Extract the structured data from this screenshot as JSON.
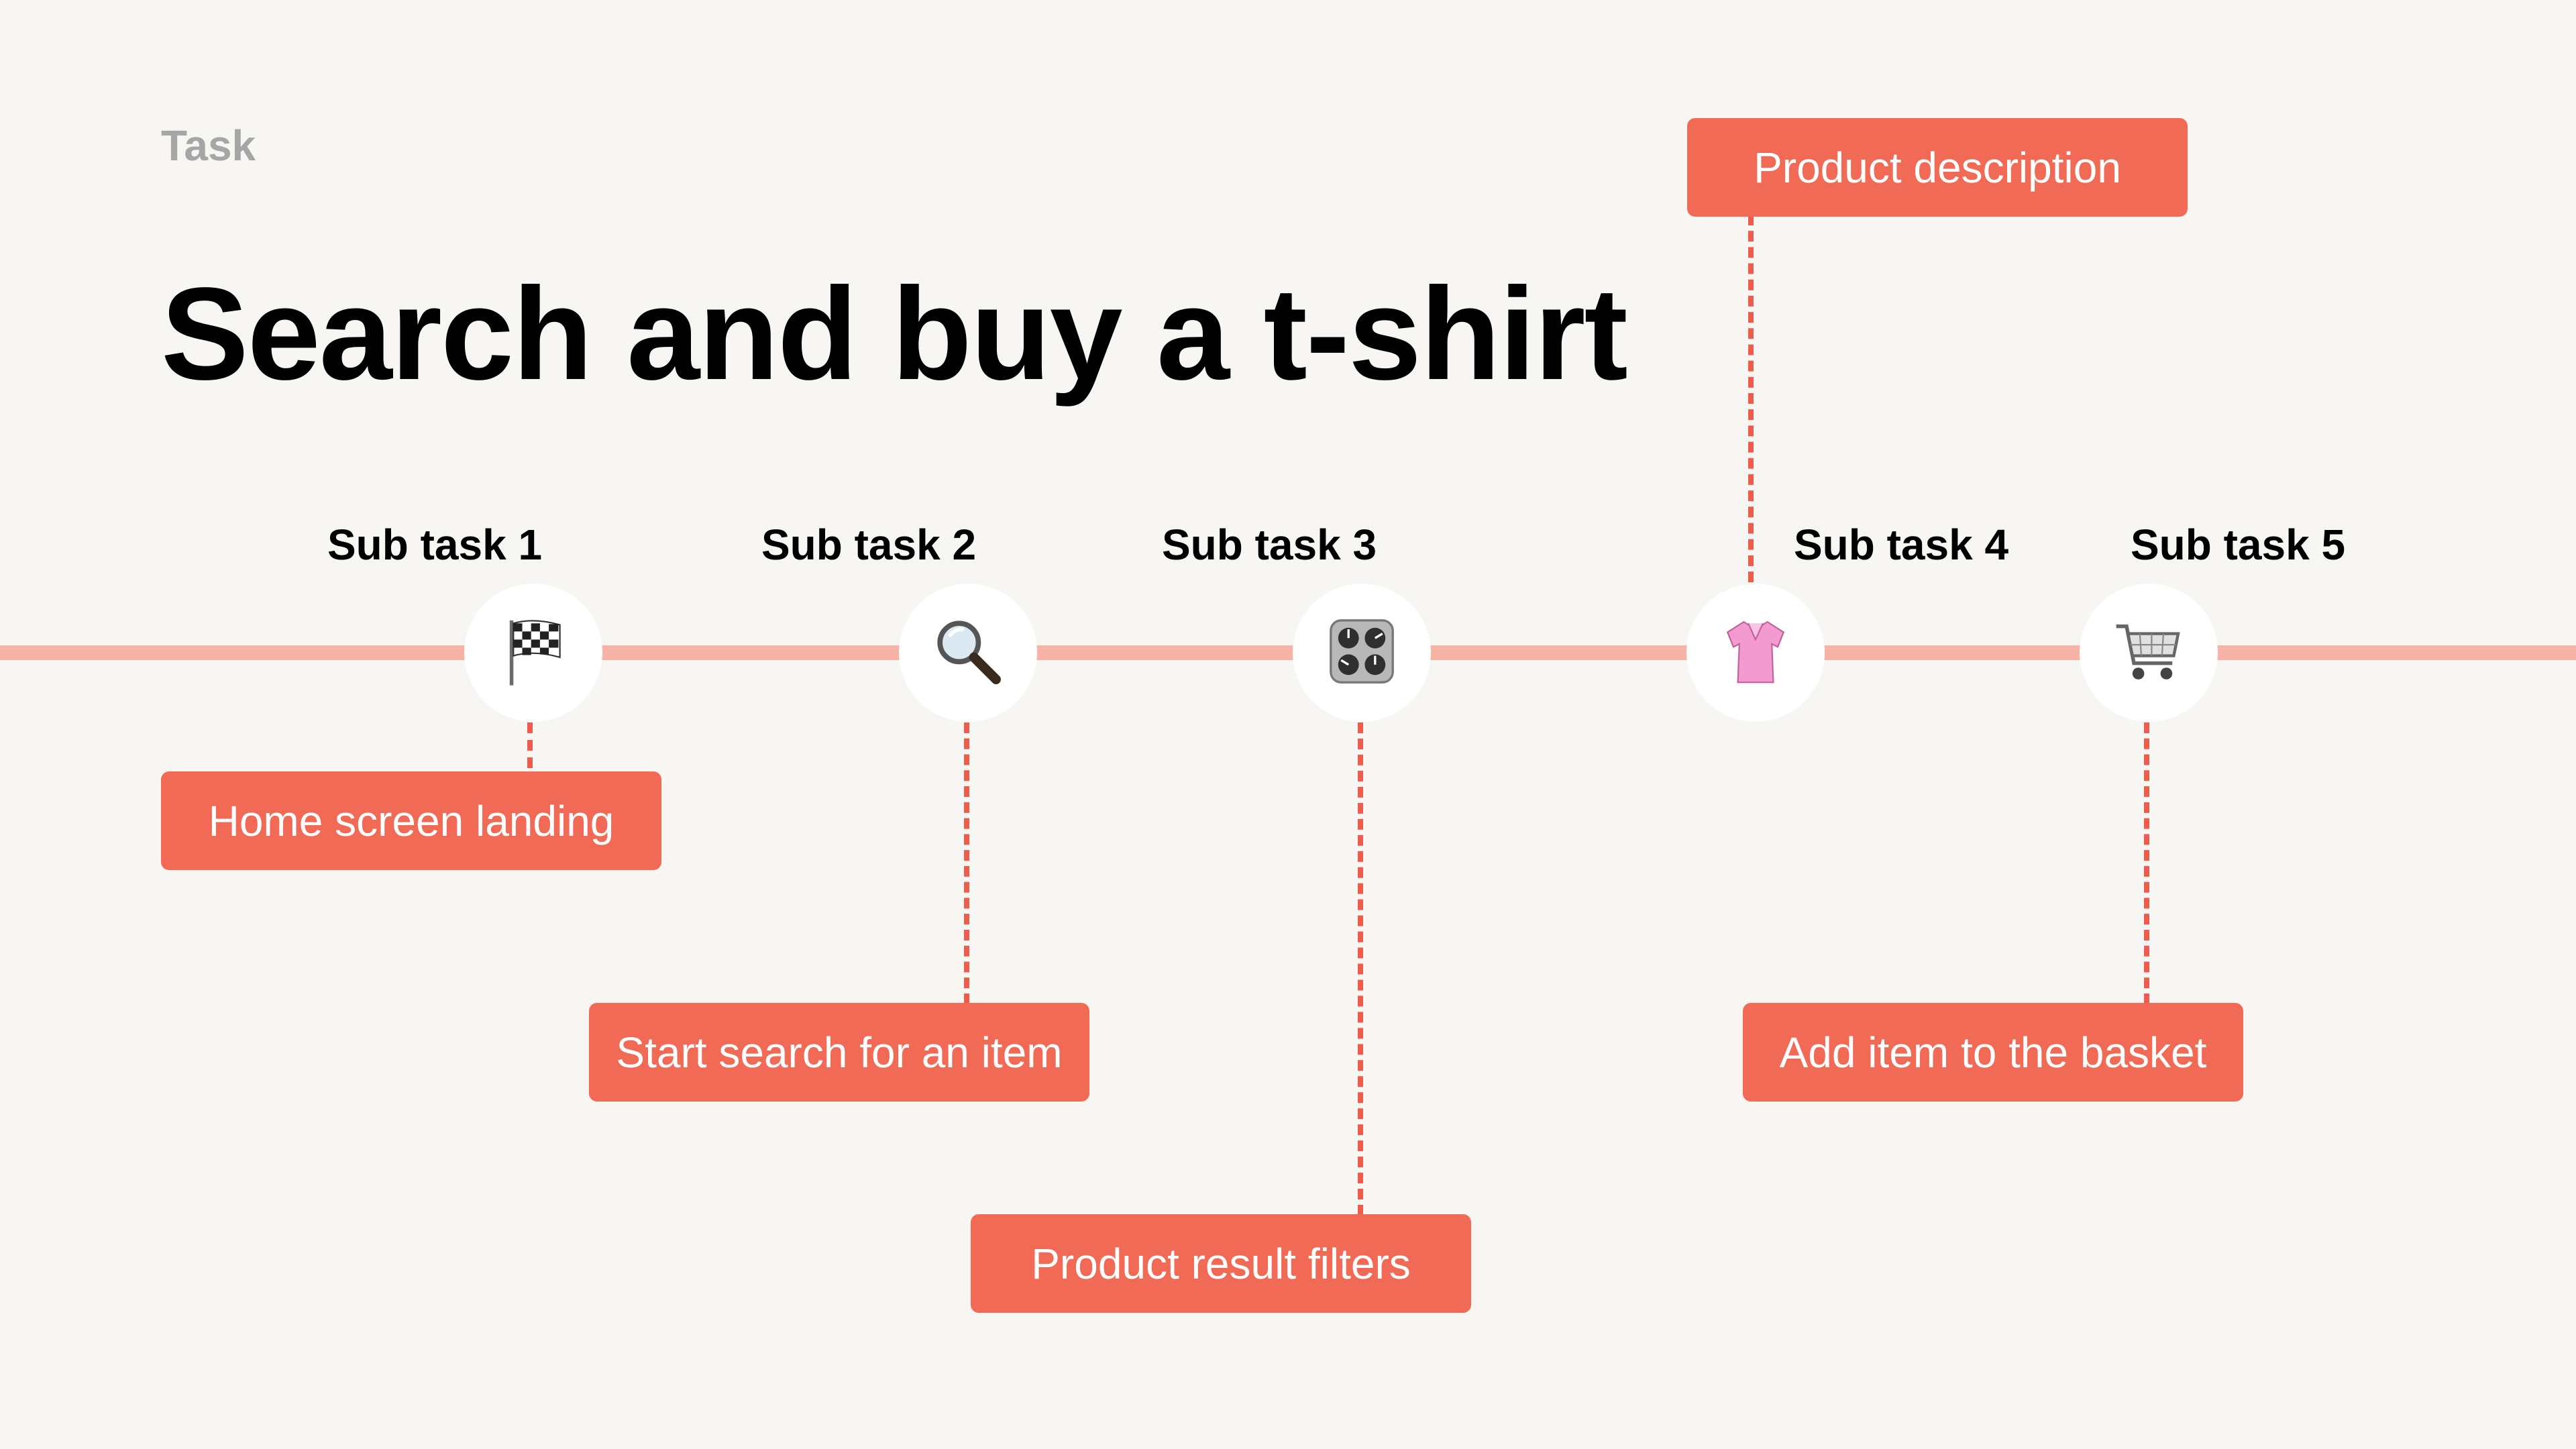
{
  "header": {
    "kicker": "Task",
    "title": "Search and buy a t-shirt"
  },
  "colors": {
    "background": "#f7f6f3",
    "timeline": "#f7b4a4",
    "callout": "#f16a56",
    "connector": "#ee5d4b"
  },
  "subtasks": [
    {
      "label": "Sub task 1",
      "icon": "checkered-flag-icon",
      "callout": "Home screen landing"
    },
    {
      "label": "Sub task 2",
      "icon": "magnifying-glass-icon",
      "callout": "Start search for an item"
    },
    {
      "label": "Sub task 3",
      "icon": "control-knobs-icon",
      "callout": "Product result filters"
    },
    {
      "label": "Sub task 4",
      "icon": "blouse-icon",
      "callout": "Product description"
    },
    {
      "label": "Sub task 5",
      "icon": "shopping-cart-icon",
      "callout": "Add item to the basket"
    }
  ]
}
